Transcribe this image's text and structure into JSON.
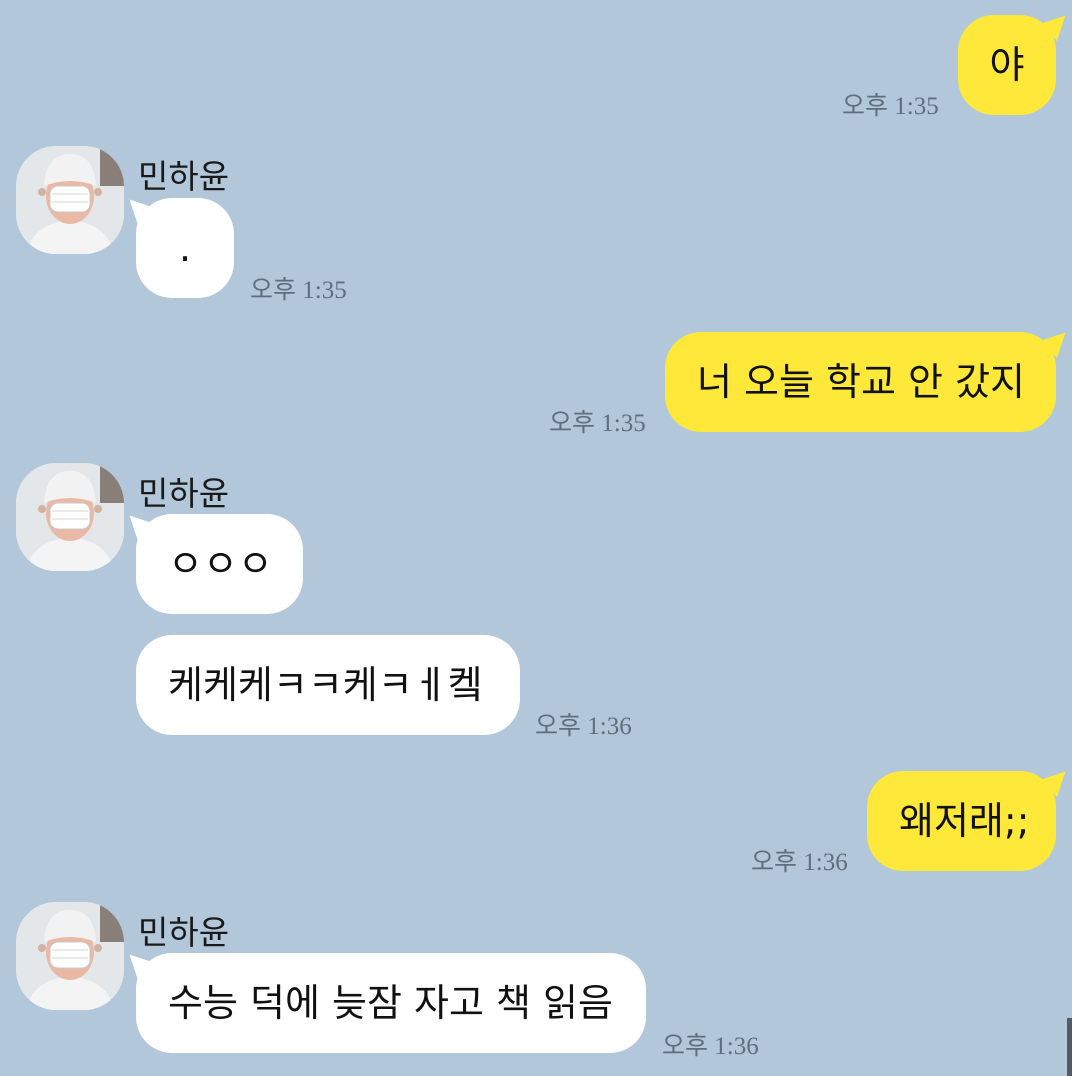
{
  "contact": {
    "name": "민하윤"
  },
  "messages": [
    {
      "sender": "me",
      "text": "야",
      "time": "오후 1:35"
    },
    {
      "sender": "contact",
      "text": ".",
      "time": "오후 1:35"
    },
    {
      "sender": "me",
      "text": "너 오늘 학교 안 갔지",
      "time": "오후 1:35"
    },
    {
      "sender": "contact",
      "text": "ㅇㅇㅇ",
      "time": ""
    },
    {
      "sender": "contact",
      "text": "케케케ㅋㅋ케ㅋㅔ켘",
      "time": "오후 1:36"
    },
    {
      "sender": "me",
      "text": "왜저래;;",
      "time": "오후 1:36"
    },
    {
      "sender": "contact",
      "text": "수능 덕에 늦잠 자고 책 읽음",
      "time": "오후 1:36"
    }
  ],
  "colors": {
    "background": "#b2c7da",
    "my_bubble": "#fee93a",
    "their_bubble": "#ffffff",
    "timestamp": "#5f6e7c"
  },
  "icons": {
    "avatar": "profile-photo-masked-person"
  }
}
